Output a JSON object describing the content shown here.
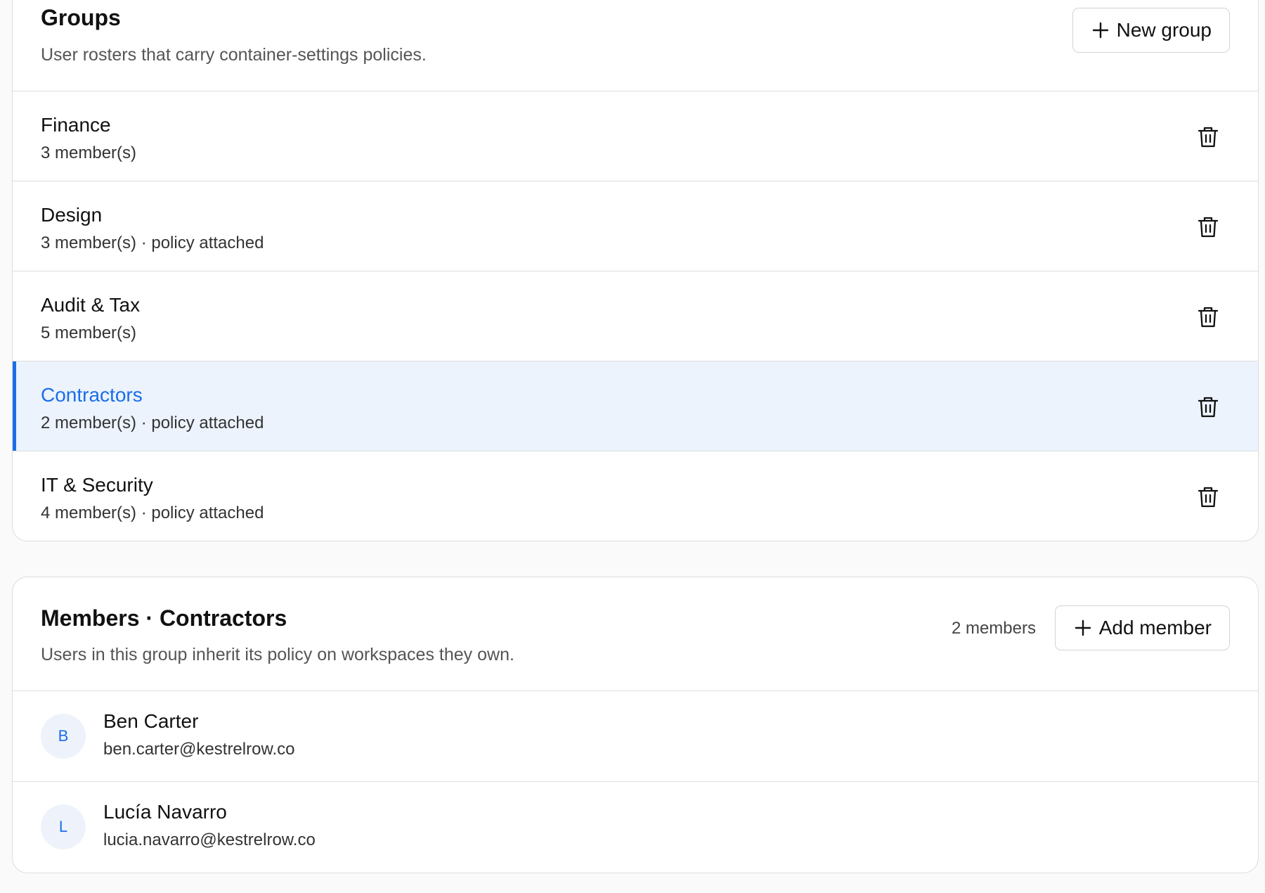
{
  "groups_panel": {
    "title": "Groups",
    "subtitle": "User rosters that carry container-settings policies.",
    "new_button_label": "New group",
    "items": [
      {
        "name": "Finance",
        "meta": "3 member(s)",
        "selected": false
      },
      {
        "name": "Design",
        "meta": "3 member(s) · policy attached",
        "selected": false
      },
      {
        "name": "Audit & Tax",
        "meta": "5 member(s)",
        "selected": false
      },
      {
        "name": "Contractors",
        "meta": "2 member(s) · policy attached",
        "selected": true
      },
      {
        "name": "IT & Security",
        "meta": "4 member(s) · policy attached",
        "selected": false
      }
    ]
  },
  "members_panel": {
    "title": "Members · Contractors",
    "subtitle": "Users in this group inherit its policy on workspaces they own.",
    "count_label": "2 members",
    "add_button_label": "Add member",
    "members": [
      {
        "initial": "B",
        "name": "Ben Carter",
        "email": "ben.carter@kestrelrow.co"
      },
      {
        "initial": "L",
        "name": "Lucía Navarro",
        "email": "lucia.navarro@kestrelrow.co"
      }
    ]
  },
  "colors": {
    "accent": "#1a6ee8",
    "selected_row_bg": "#ecf3fd",
    "avatar_bg": "#eef3fb",
    "page_bg": "#fafafa"
  },
  "icons": {
    "add": "plus-icon",
    "delete": "trash-icon"
  }
}
